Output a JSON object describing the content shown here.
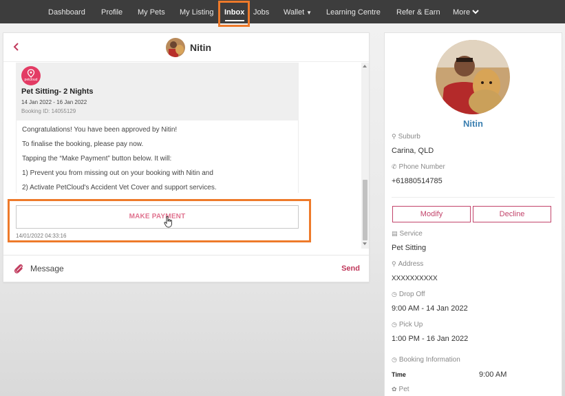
{
  "nav": {
    "items": [
      "Dashboard",
      "Profile",
      "My Pets",
      "My Listing",
      "Inbox",
      "Jobs",
      "Wallet",
      "Learning Centre",
      "Refer & Earn",
      "More"
    ]
  },
  "chat": {
    "contact_name": "Nitin",
    "booking": {
      "logo_text": "petcloud",
      "title": "Pet Sitting-  2 Nights",
      "dates": "14 Jan 2022 - 16 Jan 2022",
      "booking_id": "Booking ID: 14055129"
    },
    "message_lines": [
      "Congratulations! You have been approved by Nitin!",
      "To finalise the booking, please pay now.",
      "Tapping the “Make Payment” button below. It will:",
      "1) Prevent you from missing out on your booking with Nitin and",
      "2) Activate PetCloud's Accident Vet Cover and support services."
    ],
    "pay_button": "MAKE PAYMENT",
    "timestamp": "14/01/2022 04:33:16",
    "compose_placeholder": "Message",
    "send": "Send"
  },
  "profile": {
    "name": "Nitin",
    "suburb_label": "Suburb",
    "suburb": "Carina, QLD",
    "phone_label": "Phone Number",
    "phone": "+61880514785",
    "modify": "Modify",
    "decline": "Decline",
    "service_label": "Service",
    "service": "Pet Sitting",
    "address_label": "Address",
    "address": "XXXXXXXXXX",
    "dropoff_label": "Drop Off",
    "dropoff": "9:00 AM - 14 Jan 2022",
    "pickup_label": "Pick Up",
    "pickup": "1:00 PM - 16 Jan 2022",
    "booking_info_label": "Booking Information",
    "time_label": "Time",
    "time_value": "9:00 AM",
    "pet_label": "Pet"
  },
  "colors": {
    "nav_bg": "#3d3d3d",
    "accent": "#c2436a",
    "highlight": "#ee7a2a",
    "name_blue": "#3b7fb0"
  }
}
